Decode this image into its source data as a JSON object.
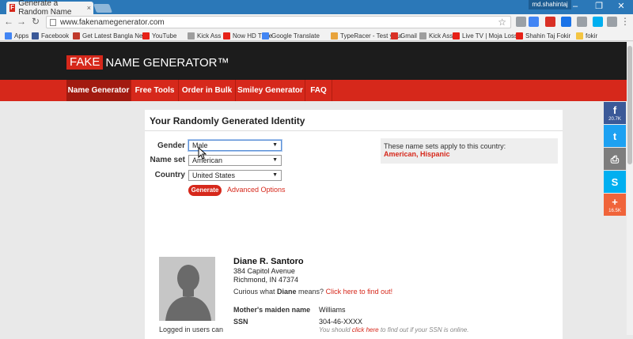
{
  "browser": {
    "tab_title": "Generate a Random Name",
    "tab_close": "×",
    "user_name": "md.shahintaj",
    "url": "www.fakenamegenerator.com",
    "window": {
      "minimize": "–",
      "maximize": "❐",
      "close": "✕"
    },
    "nav": {
      "back": "←",
      "forward": "→",
      "reload": "↻",
      "star": "☆",
      "menu": "⋮"
    },
    "extensions": [
      "tag-icon",
      "shield-icon",
      "iq-icon",
      "picture-icon",
      "skype-icon",
      "mail-icon",
      "settings-icon"
    ],
    "bookmarks": [
      {
        "label": "Apps",
        "icon": "apps-icon",
        "color": "#4285f4"
      },
      {
        "label": "Facebook",
        "icon": "facebook-icon",
        "color": "#3b5998"
      },
      {
        "label": "Get Latest Bangla Ne",
        "icon": "news-icon",
        "color": "#c0392b"
      },
      {
        "label": "YouTube",
        "icon": "youtube-icon",
        "color": "#e62117"
      },
      {
        "label": "Kick Ass",
        "icon": "page-icon",
        "color": "#9e9e9e"
      },
      {
        "label": "Now HD TIme",
        "icon": "hd-icon",
        "color": "#e62117"
      },
      {
        "label": "Google Translate",
        "icon": "translate-icon",
        "color": "#4285f4"
      },
      {
        "label": "TypeRacer - Test your",
        "icon": "typeracer-icon",
        "color": "#e8a33c"
      },
      {
        "label": "Gmail",
        "icon": "gmail-icon",
        "color": "#d93025"
      },
      {
        "label": "Kick Ass",
        "icon": "page-icon",
        "color": "#9e9e9e"
      },
      {
        "label": "Live TV | Moja Loss?",
        "icon": "tv-icon",
        "color": "#e62117"
      },
      {
        "label": "Shahin Taj Fokir",
        "icon": "youtube-icon",
        "color": "#e62117"
      },
      {
        "label": "fokir",
        "icon": "folder-icon",
        "color": "#f4c542"
      }
    ]
  },
  "site": {
    "logo_fake": "FAKE",
    "logo_rest": "NAME GENERATOR™",
    "nav": [
      "Name Generator",
      "Free Tools",
      "Order in Bulk",
      "Smiley Generator",
      "FAQ"
    ],
    "active_nav": "Name Generator"
  },
  "form": {
    "title": "Your Randomly Generated Identity",
    "gender_label": "Gender",
    "gender_value": "Male",
    "nameset_label": "Name set",
    "nameset_value": "American",
    "country_label": "Country",
    "country_value": "United States",
    "generate_label": "Generate",
    "advanced_label": "Advanced Options",
    "note_text": "These name sets apply to this country:",
    "note_countries": "American, Hispanic"
  },
  "identity": {
    "name": "Diane R. Santoro",
    "address_line1": "384 Capitol Avenue",
    "address_line2": "Richmond, IN 47374",
    "curious_prefix": "Curious what ",
    "curious_name": "Diane",
    "curious_suffix": " means? ",
    "curious_link": "Click here to find out!",
    "logged_note": "Logged in users can",
    "maiden_label": "Mother's maiden name",
    "maiden_value": "Williams",
    "ssn_label": "SSN",
    "ssn_value": "304-46-XXXX",
    "ssn_note_prefix": "You should ",
    "ssn_note_link": "click here",
    "ssn_note_suffix": " to find out if your SSN is online."
  },
  "social": [
    {
      "name": "facebook",
      "glyph": "f",
      "count": "20.7K",
      "color": "#3b5998"
    },
    {
      "name": "twitter",
      "glyph": "t",
      "count": "",
      "color": "#1da1f2"
    },
    {
      "name": "print",
      "glyph": "⎙",
      "count": "",
      "color": "#7d7d7d"
    },
    {
      "name": "skype",
      "glyph": "S",
      "count": "",
      "color": "#00aff0"
    },
    {
      "name": "more",
      "glyph": "+",
      "count": "16.5K",
      "color": "#f0643a"
    }
  ]
}
